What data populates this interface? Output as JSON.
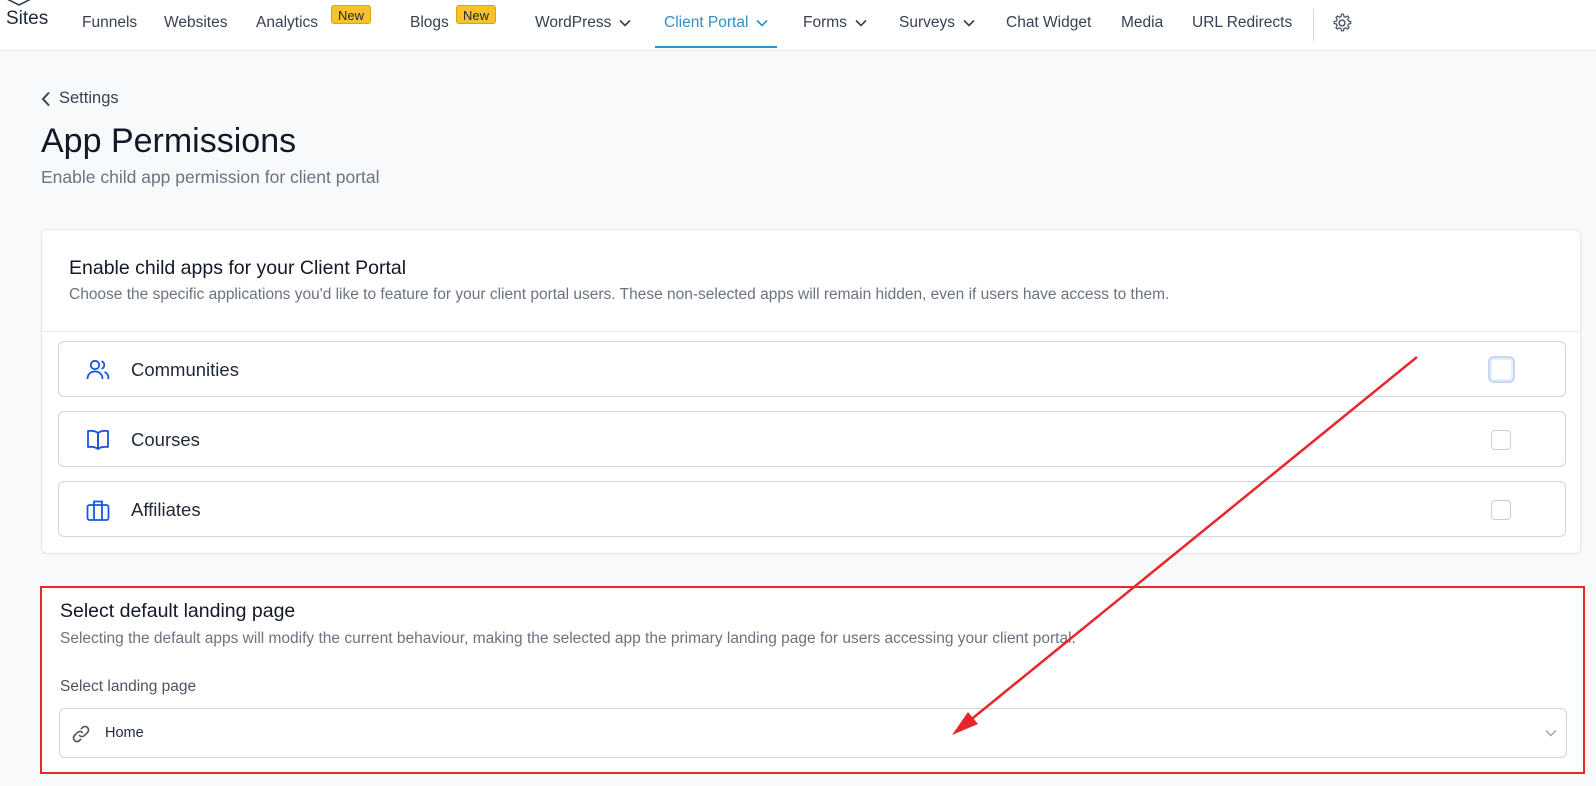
{
  "brand": {
    "name": "Sites"
  },
  "nav": {
    "items": [
      {
        "label": "Funnels"
      },
      {
        "label": "Websites"
      },
      {
        "label": "Analytics",
        "badge": "New"
      },
      {
        "label": "Blogs",
        "badge": "New"
      },
      {
        "label": "WordPress"
      },
      {
        "label": "Client Portal",
        "active": true
      },
      {
        "label": "Forms"
      },
      {
        "label": "Surveys"
      },
      {
        "label": "Chat Widget"
      },
      {
        "label": "Media"
      },
      {
        "label": "URL Redirects"
      }
    ],
    "settings_icon": "gear-icon"
  },
  "header": {
    "back_label": "Settings",
    "title": "App Permissions",
    "subtitle": "Enable child app permission for client portal"
  },
  "child_apps": {
    "title": "Enable child apps for your Client Portal",
    "description": "Choose the specific applications you'd like to feature for your client portal users. These non-selected apps will remain hidden, even if users have access to them.",
    "apps": [
      {
        "label": "Communities",
        "icon": "users-icon",
        "checked": false
      },
      {
        "label": "Courses",
        "icon": "book-icon",
        "checked": false
      },
      {
        "label": "Affiliates",
        "icon": "briefcase-icon",
        "checked": false
      }
    ]
  },
  "landing": {
    "title": "Select default landing page",
    "description": "Selecting the default apps will modify the current behaviour, making the selected app the primary landing page for users accessing your client portal.",
    "select_label": "Select landing page",
    "selected_value": "Home",
    "icon": "link-icon"
  },
  "colors": {
    "accent": "#2e90c9",
    "badge": "#f7c22b",
    "icon_blue": "#1a56db",
    "annotation_red": "#e8262b"
  }
}
